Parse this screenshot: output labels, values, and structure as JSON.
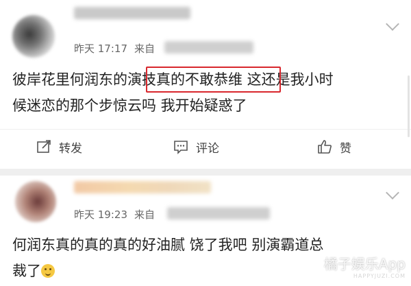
{
  "posts": [
    {
      "time": "昨天 17:17",
      "source_prefix": "来自",
      "content_before": "彼岸花里何润东的",
      "content_highlight": "演技真的不敢恭维",
      "content_after": " 这还是我小时",
      "content_line2": "候迷恋的那个步惊云吗 我开始疑惑了",
      "actions": {
        "repost": "转发",
        "comment": "评论",
        "like": "赞"
      }
    },
    {
      "time": "昨天 19:23",
      "source_prefix": "来自",
      "content_line1": "何润东真的真的真的好油腻 饶了我吧 别演霸道总",
      "content_line2": "裁了"
    }
  ],
  "watermark": {
    "text": "橘子娱乐App",
    "sub": "HAPPYJUZI.COM"
  },
  "colors": {
    "highlight_border": "#d8262c",
    "divider": "#efefef"
  }
}
